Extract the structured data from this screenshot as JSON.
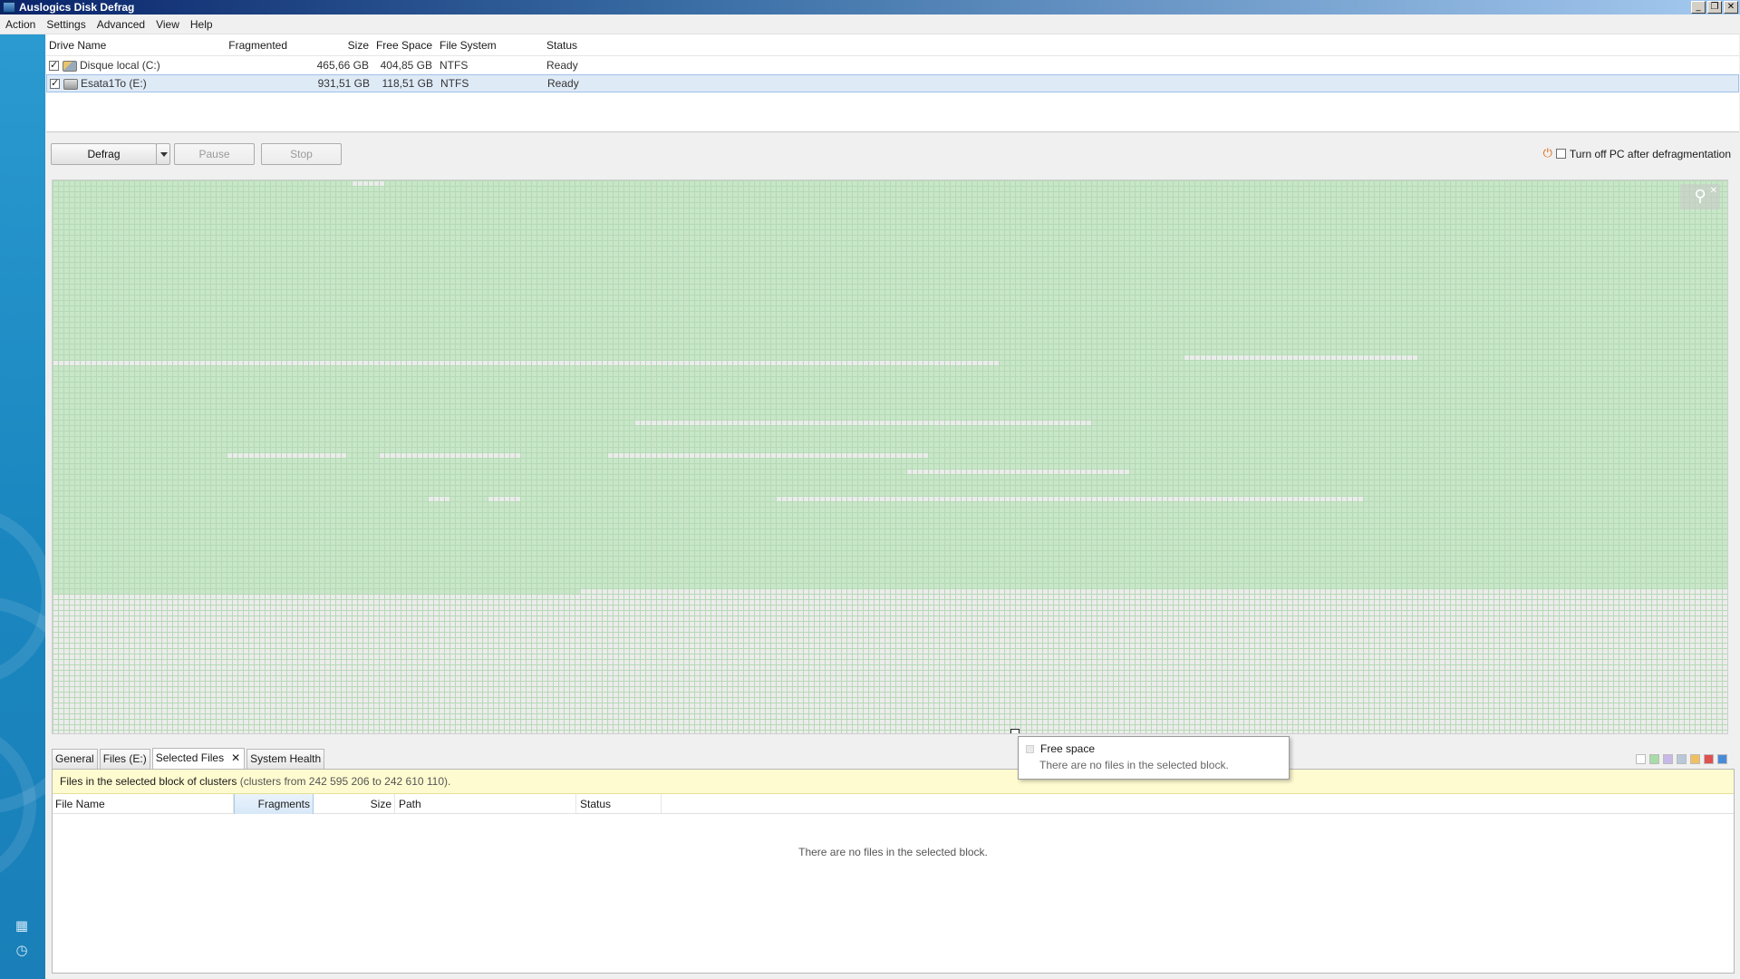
{
  "window": {
    "title": "Auslogics Disk Defrag",
    "buttons": [
      "_",
      "❐",
      "✕"
    ]
  },
  "menu": [
    "Action",
    "Settings",
    "Advanced",
    "View",
    "Help"
  ],
  "drives": {
    "columns": [
      "Drive Name",
      "Fragmented",
      "Size",
      "Free Space",
      "File System",
      "Status"
    ],
    "rows": [
      {
        "name": "Disque local (C:)",
        "fragmented": "",
        "size": "465,66 GB",
        "free": "404,85 GB",
        "fs": "NTFS",
        "status": "Ready",
        "checked": true,
        "selected": false,
        "icon": "system-drive-icon"
      },
      {
        "name": "Esata1To (E:)",
        "fragmented": "",
        "size": "931,51 GB",
        "free": "118,51 GB",
        "fs": "NTFS",
        "status": "Ready",
        "checked": true,
        "selected": true,
        "icon": "external-drive-icon"
      }
    ]
  },
  "toolbar": {
    "defrag_label": "Defrag",
    "pause_label": "Pause",
    "stop_label": "Stop",
    "turn_off_label": "Turn off PC after defragmentation",
    "turn_off_checked": false
  },
  "map": {
    "colors": {
      "used": "#c8e6c8",
      "used_border": "#b6d9b6",
      "free": "#ececec",
      "free_border": "#dcdcdc",
      "mft": "#e8dcf0"
    }
  },
  "tooltip": {
    "title": "Free space",
    "message": "There are no files in the selected block."
  },
  "tabs": [
    {
      "label": "General",
      "active": false
    },
    {
      "label": "Files (E:)",
      "active": false
    },
    {
      "label": "Selected Files",
      "active": true,
      "closable": true,
      "close_glyph": "✕"
    },
    {
      "label": "System Health",
      "active": false
    }
  ],
  "legend_colors": [
    "#ffffff",
    "#a8dca8",
    "#c8b8e8",
    "#b8c8d8",
    "#f0c060",
    "#e05050",
    "#4a8ad8"
  ],
  "selected_files": {
    "info_title": "Files in the selected block of clusters",
    "info_detail": "(clusters from 242 595 206 to 242 610 110).",
    "columns": [
      "File Name",
      "Fragments",
      "Size",
      "Path",
      "Status"
    ],
    "empty_message": "There are no files in the selected block."
  }
}
